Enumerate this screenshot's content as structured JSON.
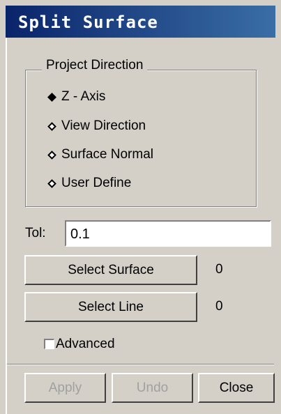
{
  "window": {
    "title": "Split Surface"
  },
  "project_direction": {
    "legend": "Project Direction",
    "options": [
      {
        "label": "Z - Axis",
        "selected": true
      },
      {
        "label": "View Direction",
        "selected": false
      },
      {
        "label": "Surface Normal",
        "selected": false
      },
      {
        "label": "User Define",
        "selected": false
      }
    ]
  },
  "tolerance": {
    "label": "Tol:",
    "value": "0.1"
  },
  "select_surface": {
    "label": "Select Surface",
    "count": "0"
  },
  "select_line": {
    "label": "Select Line",
    "count": "0"
  },
  "advanced": {
    "label": "Advanced",
    "checked": false
  },
  "footer": {
    "apply_label": "Apply",
    "undo_label": "Undo",
    "close_label": "Close"
  }
}
